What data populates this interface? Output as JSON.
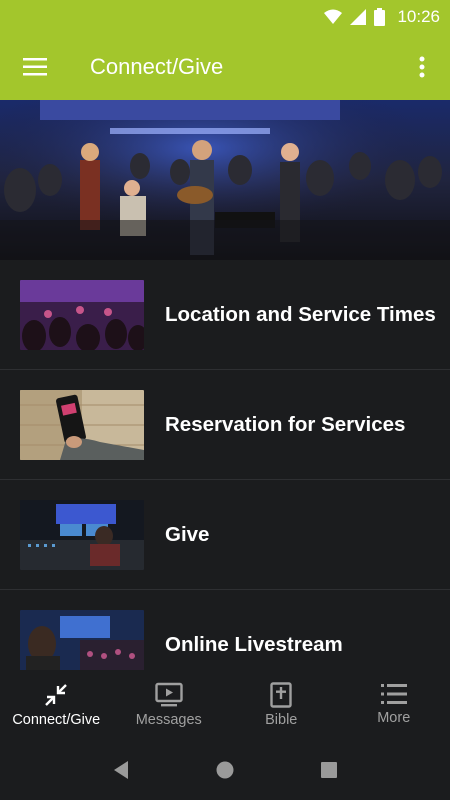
{
  "status_bar": {
    "time": "10:26"
  },
  "app_bar": {
    "title": "Connect/Give"
  },
  "list": [
    {
      "label": "Location and Service Times",
      "thumb": "worship-crowd-photo"
    },
    {
      "label": "Reservation for Services",
      "thumb": "phone-in-hand-photo"
    },
    {
      "label": "Give",
      "thumb": "sound-booth-photo"
    },
    {
      "label": "Online Livestream",
      "thumb": "stage-livestream-photo"
    }
  ],
  "bottom_nav": [
    {
      "label": "Connect/Give",
      "icon": "connect-arrows-icon",
      "active": true
    },
    {
      "label": "Messages",
      "icon": "video-play-icon",
      "active": false
    },
    {
      "label": "Bible",
      "icon": "bible-cross-icon",
      "active": false
    },
    {
      "label": "More",
      "icon": "list-menu-icon",
      "active": false
    }
  ],
  "colors": {
    "accent": "#a3c62c",
    "background": "#1b1c1e",
    "inactive": "#a0a0a0"
  }
}
